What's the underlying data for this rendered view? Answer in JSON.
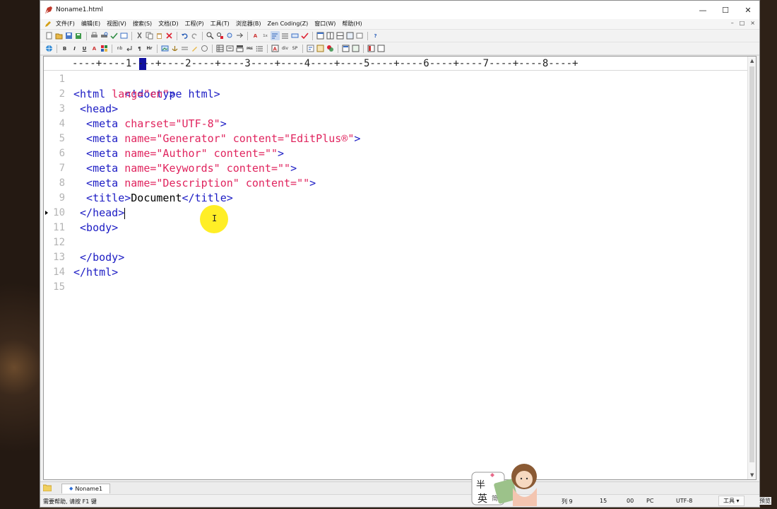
{
  "window": {
    "title": "Noname1.html"
  },
  "menu": [
    "文件(F)",
    "编辑(E)",
    "视图(V)",
    "搜索(S)",
    "文档(D)",
    "工程(P)",
    "工具(T)",
    "浏览器(B)",
    "Zen Coding(Z)",
    "窗口(W)",
    "帮助(H)"
  ],
  "toolbar2_labels": {
    "bold": "B",
    "italic": "I",
    "underline": "U",
    "a": "A",
    "nb": "nb",
    "para": "¶",
    "hr": "Hr",
    "div": "div",
    "sp": "SP",
    "pre": "PRE"
  },
  "ruler": "----+----1----+----2----+----3----+----4----+----5----+----6----+----7----+----8----+",
  "line_numbers": [
    "1",
    "2",
    "3",
    "4",
    "5",
    "6",
    "7",
    "8",
    "9",
    "10",
    "11",
    "12",
    "13",
    "14",
    "15"
  ],
  "code": {
    "l1_a": "<!doctype html>",
    "l2_a": "<html",
    "l2_b": " lang=",
    "l2_c": "\"en\"",
    "l2_d": ">",
    "l3_a": " <head>",
    "l4_a": "  <meta",
    "l4_b": " charset=",
    "l4_c": "\"UTF-8\"",
    "l4_d": ">",
    "l5_a": "  <meta",
    "l5_b": " name=",
    "l5_c": "\"Generator\"",
    "l5_d": " content=",
    "l5_e": "\"EditPlus®\"",
    "l5_f": ">",
    "l6_a": "  <meta",
    "l6_b": " name=",
    "l6_c": "\"Author\"",
    "l6_d": " content=",
    "l6_e": "\"\"",
    "l6_f": ">",
    "l7_a": "  <meta",
    "l7_b": " name=",
    "l7_c": "\"Keywords\"",
    "l7_d": " content=",
    "l7_e": "\"\"",
    "l7_f": ">",
    "l8_a": "  <meta",
    "l8_b": " name=",
    "l8_c": "\"Description\"",
    "l8_d": " content=",
    "l8_e": "\"\"",
    "l8_f": ">",
    "l9_a": "  <title>",
    "l9_b": "Document",
    "l9_c": "</title>",
    "l10_a": " </head>",
    "l11_a": " <body>",
    "l13_a": " </body>",
    "l14_a": "</html>"
  },
  "tabs": [
    {
      "label": "Noname1"
    }
  ],
  "status": {
    "help": "需要帮助, 请按 F1 键",
    "col": "列 9",
    "line_count": "15",
    "code": "00",
    "newline": "PC",
    "encoding": "UTF-8",
    "tools": "工具 ▾",
    "preview": "预览"
  },
  "mascot": {
    "text1": "半",
    "text2": "英",
    "text3": "简"
  },
  "colors": {
    "tag": "#1c1cc4",
    "attr": "#e0245e",
    "cursor_highlight": "#ffeb00"
  }
}
